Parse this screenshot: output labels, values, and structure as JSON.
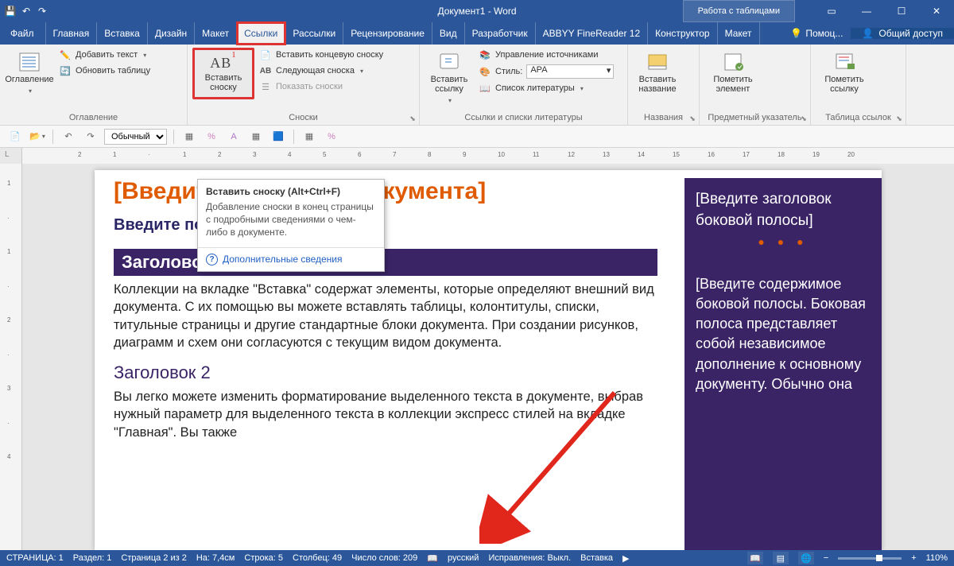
{
  "titlebar": {
    "title": "Документ1 - Word",
    "table_tools": "Работа с таблицами"
  },
  "tabs": {
    "file": "Файл",
    "items": [
      "Главная",
      "Вставка",
      "Дизайн",
      "Макет",
      "Ссылки",
      "Рассылки",
      "Рецензирование",
      "Вид",
      "Разработчик",
      "ABBYY FineReader 12",
      "Конструктор",
      "Макет"
    ],
    "active_index": 4,
    "help": "Помоц...",
    "share": "Общий доступ"
  },
  "ribbon": {
    "toc": {
      "big": "Оглавление",
      "add_text": "Добавить текст",
      "update_table": "Обновить таблицу",
      "group": "Оглавление"
    },
    "footnotes": {
      "insert_footnote": "Вставить\nсноску",
      "ab_label": "AB",
      "insert_endnote": "Вставить концевую сноску",
      "next_footnote": "Следующая сноска",
      "show_notes": "Показать сноски",
      "group": "Сноски"
    },
    "citations": {
      "insert_citation": "Вставить\nссылку",
      "manage_sources": "Управление источниками",
      "style_label": "Стиль:",
      "style_value": "APA",
      "bibliography": "Список литературы",
      "group": "Ссылки и списки литературы"
    },
    "captions": {
      "insert_caption": "Вставить\nназвание",
      "group": "Названия"
    },
    "index": {
      "mark_entry": "Пометить\nэлемент",
      "group": "Предметный указатель"
    },
    "toa": {
      "mark_citation": "Пометить\nссылку",
      "group": "Таблица ссылок"
    }
  },
  "tooltip": {
    "title": "Вставить сноску (Alt+Ctrl+F)",
    "body": "Добавление сноски в конец страницы с подробными сведениями о чем-либо в документе.",
    "link": "Дополнительные сведения"
  },
  "mini": {
    "style": "Обычный"
  },
  "ruler_numbers": [
    "2",
    "1",
    "",
    "1",
    "2",
    "3",
    "4",
    "5",
    "6",
    "7",
    "8",
    "9",
    "10",
    "11",
    "12",
    "13",
    "14",
    "15",
    "16",
    "17",
    "18",
    "19",
    "20"
  ],
  "document": {
    "title": "[Введите заголовок документа]",
    "subtitle": "Введите подзаголовок документа",
    "h1": "Заголовок 1",
    "p1": "Коллекции на вкладке \"Вставка\" содержат элементы, которые определяют внешний вид документа. С их помощью вы можете вставлять таблицы, колонтитулы, списки, титульные страницы и другие стандартные блоки документа. При создании рисунков, диаграмм и схем они согласуются с текущим видом документа.",
    "h2": "Заголовок 2",
    "p2": "Вы легко можете изменить форматирование выделенного текста в документе, выбрав нужный параметр для выделенного текста в коллекции экспресс стилей на вкладке \"Главная\". Вы также",
    "sidebar_title": "[Введите заголовок боковой полосы]",
    "sidebar_body": "[Введите содержимое боковой полосы. Боковая полоса представляет собой независимое дополнение к основному документу. Обычно она"
  },
  "status": {
    "page": "СТРАНИЦА: 1",
    "section": "Раздел: 1",
    "pages": "Страница 2 из 2",
    "at": "На: 7,4см",
    "line": "Строка: 5",
    "column": "Столбец: 49",
    "words": "Число слов: 209",
    "lang": "русский",
    "track": "Исправления: Выкл.",
    "insert": "Вставка",
    "zoom": "110%"
  }
}
